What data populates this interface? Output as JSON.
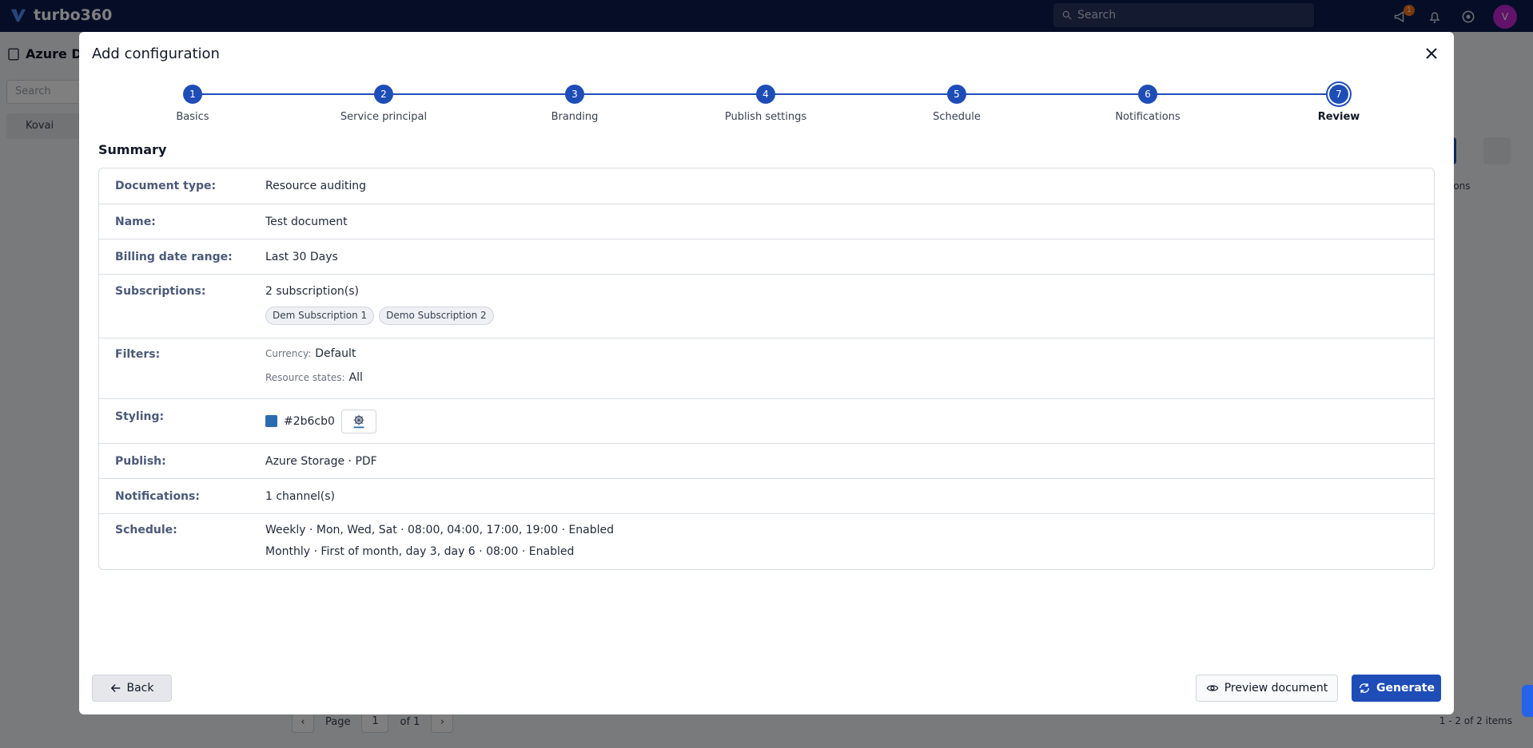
{
  "app": {
    "name": "turbo360",
    "search_placeholder": "Search",
    "notification_count": "1",
    "avatar_initial": "V",
    "side_title": "Azure Do",
    "side_search": "Search",
    "side_item": "Kovai",
    "right_col": "ions",
    "pager": {
      "page_label": "Page",
      "page_value": "1",
      "of_label": "of 1"
    },
    "item_count": "1 - 2 of 2 items"
  },
  "modal": {
    "title": "Add configuration",
    "steps": [
      {
        "num": "1",
        "label": "Basics"
      },
      {
        "num": "2",
        "label": "Service principal"
      },
      {
        "num": "3",
        "label": "Branding"
      },
      {
        "num": "4",
        "label": "Publish settings"
      },
      {
        "num": "5",
        "label": "Schedule"
      },
      {
        "num": "6",
        "label": "Notifications"
      },
      {
        "num": "7",
        "label": "Review"
      }
    ],
    "active_step": 7,
    "summary_heading": "Summary",
    "summary": {
      "document_type": {
        "label": "Document type:",
        "value": "Resource auditing"
      },
      "name": {
        "label": "Name:",
        "value": "Test document"
      },
      "billing": {
        "label": "Billing date range:",
        "value": "Last 30 Days"
      },
      "subscriptions": {
        "label": "Subscriptions:",
        "value": "2 subscription(s)",
        "chips": [
          "Dem Subscription 1",
          "Demo Subscription 2"
        ]
      },
      "filters": {
        "label": "Filters:",
        "currency_key": "Currency:",
        "currency_value": "Default",
        "states_key": "Resource states:",
        "states_value": "All"
      },
      "styling": {
        "label": "Styling:",
        "color": "#2b6cb0",
        "color_text": "#2b6cb0"
      },
      "publish": {
        "label": "Publish:",
        "value": "Azure Storage · PDF"
      },
      "notifications": {
        "label": "Notifications:",
        "value": "1 channel(s)"
      },
      "schedule": {
        "label": "Schedule:",
        "lines": [
          "Weekly · Mon, Wed, Sat · 08:00, 04:00, 17:00, 19:00 · Enabled",
          "Monthly · First of month, day 3, day 6 · 08:00 · Enabled"
        ]
      }
    },
    "buttons": {
      "back": "Back",
      "preview": "Preview document",
      "generate": "Generate"
    }
  },
  "colors": {
    "primary": "#1e4db7",
    "topbar": "#0b1c4d",
    "label": "#4a5a78"
  }
}
